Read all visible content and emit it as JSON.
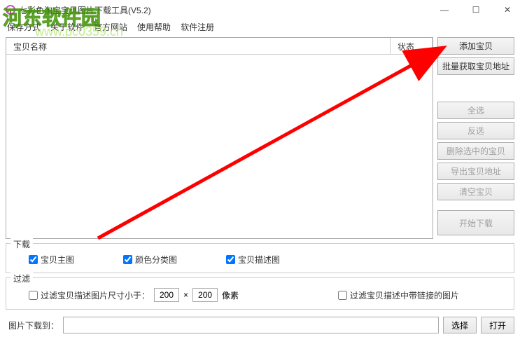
{
  "window": {
    "title": "七彩色淘宝宝贝图片下载工具(V5.2)"
  },
  "menu": {
    "item1": "保存方式",
    "item2": "关于软件",
    "item3": "官方网站",
    "item4": "使用帮助",
    "item5": "软件注册"
  },
  "table": {
    "col1": "宝贝名称",
    "col2": "状态"
  },
  "buttons": {
    "add": "添加宝贝",
    "batch": "批量获取宝贝地址",
    "all": "全选",
    "invert": "反选",
    "delete": "删除选中的宝贝",
    "export": "导出宝贝地址",
    "clear": "清空宝贝",
    "start": "开始下载",
    "choose": "选择",
    "open": "打开"
  },
  "groups": {
    "download": "下载",
    "filter": "过滤",
    "chk_main": "宝贝主图",
    "chk_color": "颜色分类图",
    "chk_desc": "宝贝描述图",
    "filter_size_label": "过滤宝贝描述图片尺寸小于：",
    "filter_size_w": "200",
    "filter_size_h": "200",
    "filter_size_unit": "像素",
    "filter_link": "过滤宝贝描述中带链接的图片"
  },
  "bottom": {
    "label": "图片下载到：",
    "path": ""
  },
  "watermark": {
    "logo": "河东软件园",
    "url": "www.pc0359.cn"
  }
}
